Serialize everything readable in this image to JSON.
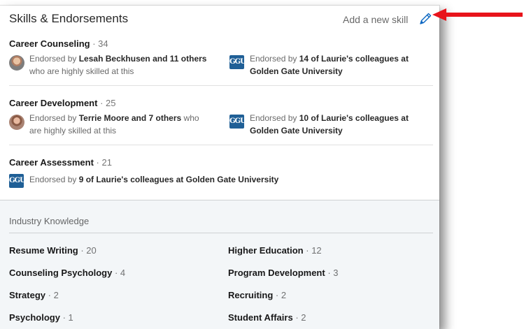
{
  "header": {
    "title": "Skills & Endorsements",
    "add_skill_label": "Add a new skill",
    "edit_icon": "pencil-icon"
  },
  "top_skills": [
    {
      "name": "Career Counseling",
      "count": "34",
      "endorsement_people": {
        "prefix": "Endorsed by ",
        "bold": "Lesah Beckhusen and 11 others",
        "suffix": " who are highly skilled at this"
      },
      "endorsement_org": {
        "prefix": "Endorsed by ",
        "bold": "14 of Laurie's colleagues at Golden Gate University",
        "suffix": ""
      }
    },
    {
      "name": "Career Development",
      "count": "25",
      "endorsement_people": {
        "prefix": "Endorsed by ",
        "bold": "Terrie Moore and 7 others",
        "suffix": " who are highly skilled at this"
      },
      "endorsement_org": {
        "prefix": "Endorsed by ",
        "bold": "10 of Laurie's colleagues at Golden Gate University",
        "suffix": ""
      }
    },
    {
      "name": "Career Assessment",
      "count": "21",
      "endorsement_org": {
        "prefix": "Endorsed by ",
        "bold": "9 of Laurie's colleagues at Golden Gate University",
        "suffix": ""
      }
    }
  ],
  "org_logo_text": "GGU",
  "industry": {
    "label": "Industry Knowledge",
    "skills": [
      {
        "name": "Resume Writing",
        "count": "20"
      },
      {
        "name": "Higher Education",
        "count": "12"
      },
      {
        "name": "Counseling Psychology",
        "count": "4"
      },
      {
        "name": "Program Development",
        "count": "3"
      },
      {
        "name": "Strategy",
        "count": "2"
      },
      {
        "name": "Recruiting",
        "count": "2"
      },
      {
        "name": "Psychology",
        "count": "1"
      },
      {
        "name": "Student Affairs",
        "count": "2"
      }
    ]
  },
  "separator": " · ",
  "colors": {
    "accent_arrow": "#e8141b",
    "logo_blue": "#1f5f96",
    "industry_bg": "#f3f6f8"
  }
}
